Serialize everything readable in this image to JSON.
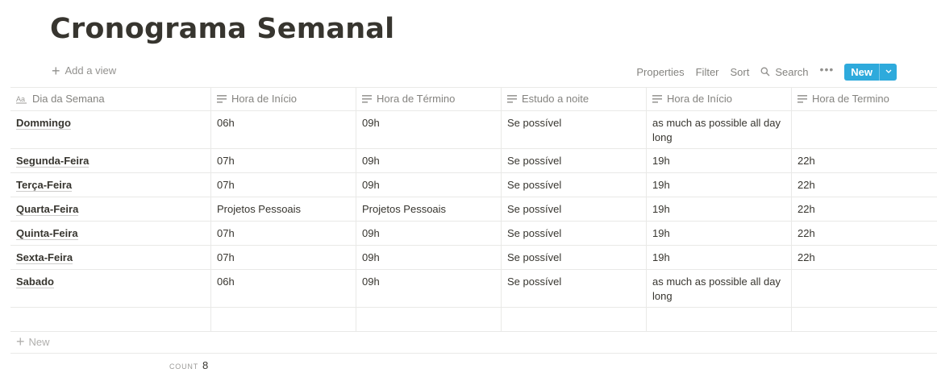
{
  "page": {
    "title": "Cronograma Semanal"
  },
  "toolbar": {
    "add_view": "Add a view",
    "properties": "Properties",
    "filter": "Filter",
    "sort": "Sort",
    "search": "Search",
    "more": "•••",
    "new": "New",
    "accent_color": "#2eaadc"
  },
  "table": {
    "columns": [
      {
        "label": "Dia da Semana",
        "icon": "title-property-icon"
      },
      {
        "label": "Hora de Início",
        "icon": "text-property-icon"
      },
      {
        "label": "Hora de Término",
        "icon": "text-property-icon"
      },
      {
        "label": "Estudo a noite",
        "icon": "text-property-icon"
      },
      {
        "label": "Hora de Início",
        "icon": "text-property-icon"
      },
      {
        "label": "Hora de Termino",
        "icon": "text-property-icon"
      }
    ],
    "rows": [
      [
        "Dommingo",
        "06h",
        "09h",
        "Se possível",
        "as much as possible all day long",
        ""
      ],
      [
        "Segunda-Feira",
        "07h",
        "09h",
        "Se possível",
        "19h",
        "22h"
      ],
      [
        "Terça-Feira",
        "07h",
        "09h",
        "Se possível",
        "19h",
        "22h"
      ],
      [
        "Quarta-Feira",
        "Projetos Pessoais",
        "Projetos Pessoais",
        "Se possível",
        "19h",
        "22h"
      ],
      [
        "Quinta-Feira",
        "07h",
        "09h",
        "Se possível",
        "19h",
        "22h"
      ],
      [
        "Sexta-Feira",
        "07h",
        "09h",
        "Se possível",
        "19h",
        "22h"
      ],
      [
        "Sabado",
        "06h",
        "09h",
        "Se possível",
        "as much as possible all day long",
        ""
      ],
      [
        "",
        "",
        "",
        "",
        "",
        ""
      ]
    ],
    "new_row": "New"
  },
  "footer": {
    "count_label": "COUNT",
    "count_value": "8"
  }
}
